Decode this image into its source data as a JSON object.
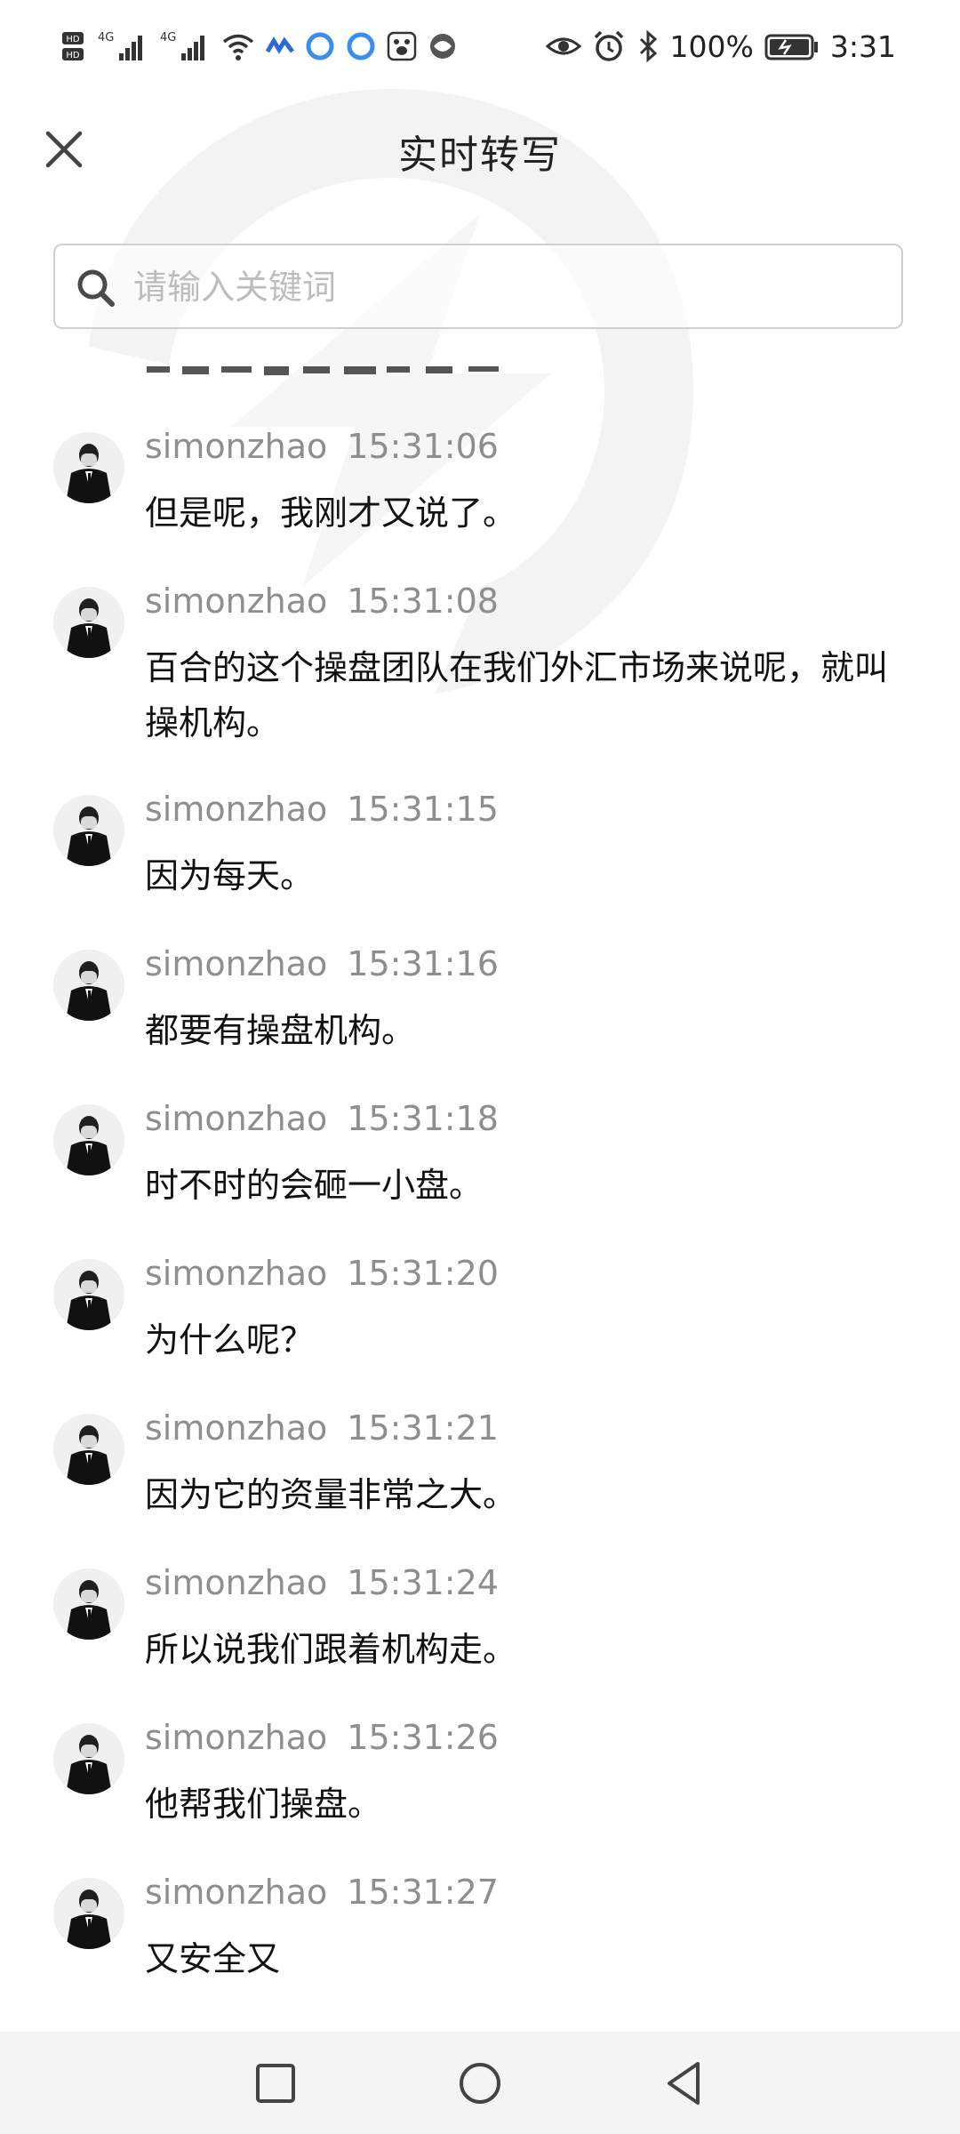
{
  "status_bar": {
    "battery": "100%",
    "time": "3:31",
    "left_icons": [
      "hd-icon",
      "signal-4g-icon",
      "signal-4g-icon",
      "wifi-icon",
      "app-notification-icon",
      "app-notification-icon",
      "app-notification-icon",
      "baidu-icon",
      "browser-icon"
    ],
    "right_icons": [
      "eye-icon",
      "alarm-icon",
      "bluetooth-icon",
      "battery-icon"
    ]
  },
  "header": {
    "title": "实时转写",
    "close_icon": "close-icon"
  },
  "search": {
    "placeholder": "请输入关键词",
    "value": ""
  },
  "messages": [
    {
      "user": "simonzhao",
      "time": "15:31:06",
      "text": "但是呢，我刚才又说了。"
    },
    {
      "user": "simonzhao",
      "time": "15:31:08",
      "text": "百合的这个操盘团队在我们外汇市场来说呢，就叫操机构。"
    },
    {
      "user": "simonzhao",
      "time": "15:31:15",
      "text": "因为每天。"
    },
    {
      "user": "simonzhao",
      "time": "15:31:16",
      "text": "都要有操盘机构。"
    },
    {
      "user": "simonzhao",
      "time": "15:31:18",
      "text": "时不时的会砸一小盘。"
    },
    {
      "user": "simonzhao",
      "time": "15:31:20",
      "text": "为什么呢？"
    },
    {
      "user": "simonzhao",
      "time": "15:31:21",
      "text": "因为它的资量非常之大。"
    },
    {
      "user": "simonzhao",
      "time": "15:31:24",
      "text": "所以说我们跟着机构走。"
    },
    {
      "user": "simonzhao",
      "time": "15:31:26",
      "text": "他帮我们操盘。"
    },
    {
      "user": "simonzhao",
      "time": "15:31:27",
      "text": "又安全又"
    }
  ],
  "nav_bar": {
    "buttons": [
      "recent-apps-icon",
      "home-icon",
      "back-icon"
    ]
  }
}
